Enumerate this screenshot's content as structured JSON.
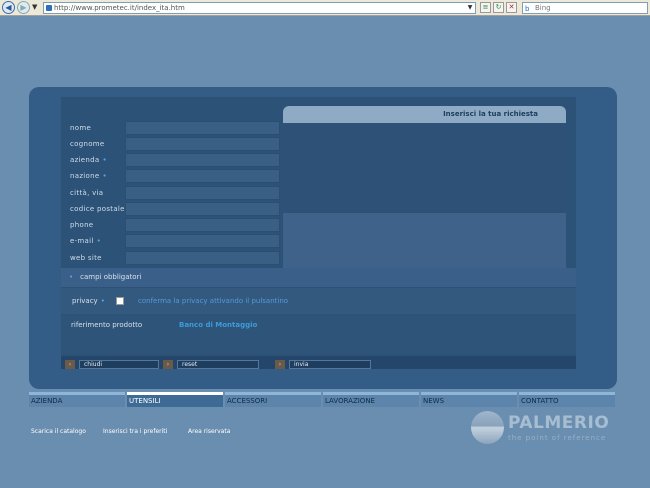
{
  "browser": {
    "url": "http://www.prometec.it/index_ita.htm",
    "search_placeholder": "Bing"
  },
  "form": {
    "header": "Inserisci la tua richiesta",
    "fields": [
      {
        "label": "nome",
        "required": false
      },
      {
        "label": "cognome",
        "required": false
      },
      {
        "label": "azienda",
        "required": true
      },
      {
        "label": "nazione",
        "required": true
      },
      {
        "label": "città, via",
        "required": false
      },
      {
        "label": "codice postale",
        "required": false
      },
      {
        "label": "phone",
        "required": false
      },
      {
        "label": "e-mail",
        "required": true
      },
      {
        "label": "web site",
        "required": false
      }
    ],
    "required_dot": "•",
    "required_note": "campi obbligatori",
    "privacy_label": "privacy",
    "privacy_note": "conferma la privacy attivando il pulsantino",
    "reference_label": "riferimento  prodotto",
    "reference_value": "Banco di Montaggio",
    "buttons": [
      "chiudi",
      "reset",
      "invia"
    ],
    "button_arrow": "›"
  },
  "nav": {
    "items": [
      "AZIENDA",
      "UTENSILI",
      "ACCESSORI",
      "LAVORAZIONE",
      "NEWS",
      "CONTATTO"
    ],
    "active_index": 1
  },
  "footer": {
    "links": [
      "Scarica il catalogo",
      "Inserisci tra i preferiti",
      "Area riservata"
    ]
  },
  "logo": {
    "name": "PALMERIO",
    "tagline": "the point of reference"
  },
  "colors": {
    "page_bg": "#6a8eb0",
    "panel_bg": "#335d86",
    "accent": "#3c9cdb"
  }
}
